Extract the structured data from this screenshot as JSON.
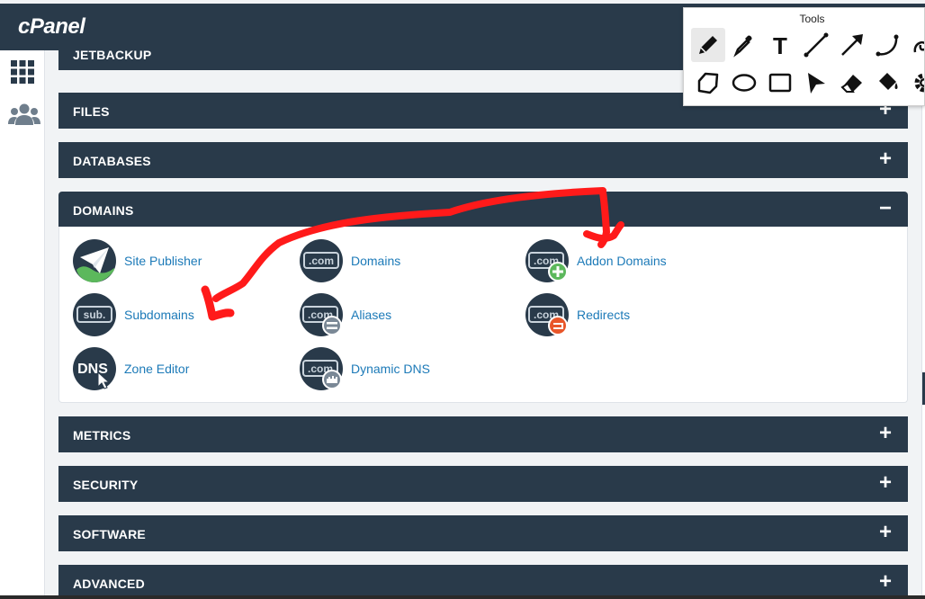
{
  "brand": {
    "logo_text": "cPanel"
  },
  "leftnav": {
    "items": [
      {
        "icon": "grid-icon"
      },
      {
        "icon": "users-icon"
      }
    ]
  },
  "panels": {
    "jetbackup": {
      "title": "JETBACKUP"
    },
    "files": {
      "title": "FILES",
      "toggle": "+"
    },
    "databases": {
      "title": "DATABASES",
      "toggle": "+"
    },
    "domains": {
      "title": "DOMAINS",
      "toggle": "−"
    },
    "metrics": {
      "title": "METRICS",
      "toggle": "+"
    },
    "security": {
      "title": "SECURITY",
      "toggle": "+"
    },
    "software": {
      "title": "SOFTWARE",
      "toggle": "+"
    },
    "advanced": {
      "title": "ADVANCED",
      "toggle": "+"
    }
  },
  "domains_items": [
    {
      "label": "Site Publisher",
      "icon": "paper-plane-icon"
    },
    {
      "label": "Domains",
      "icon": "com-icon",
      "icon_text": ".com"
    },
    {
      "label": "Addon Domains",
      "icon": "com-plus-icon",
      "icon_text": ".com"
    },
    {
      "label": "Subdomains",
      "icon": "sub-icon",
      "icon_text": "sub."
    },
    {
      "label": "Aliases",
      "icon": "com-equals-icon",
      "icon_text": ".com"
    },
    {
      "label": "Redirects",
      "icon": "com-redirect-icon",
      "icon_text": ".com"
    },
    {
      "label": "Zone Editor",
      "icon": "dns-icon",
      "icon_text": "DNS"
    },
    {
      "label": "Dynamic DNS",
      "icon": "com-dynamic-icon",
      "icon_text": ".com"
    }
  ],
  "tools_palette": {
    "title": "Tools",
    "tools": [
      {
        "name": "pencil",
        "active": true
      },
      {
        "name": "eyedropper"
      },
      {
        "name": "text",
        "glyph": "T"
      },
      {
        "name": "line"
      },
      {
        "name": "arrow"
      },
      {
        "name": "curve"
      },
      {
        "name": "freehand"
      },
      {
        "name": "polygon"
      },
      {
        "name": "ellipse"
      },
      {
        "name": "rectangle"
      },
      {
        "name": "pointer"
      },
      {
        "name": "eraser"
      },
      {
        "name": "fill-bucket"
      },
      {
        "name": "settings"
      }
    ]
  },
  "colors": {
    "header_bg": "#293a4a",
    "link": "#1c7ab8",
    "annotation": "#ff1a1a",
    "plus_green": "#5cb85c",
    "redirect_orange": "#e8562a"
  }
}
